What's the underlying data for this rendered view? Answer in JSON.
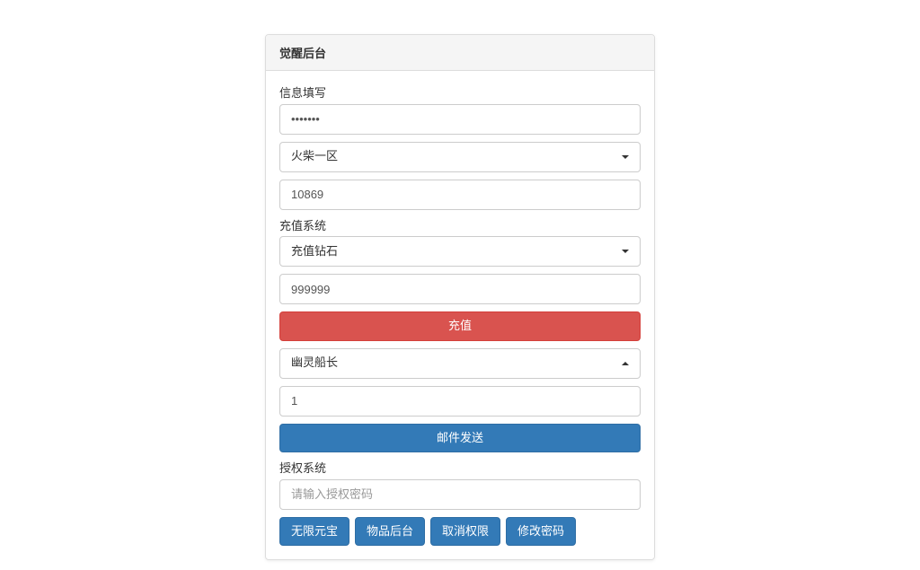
{
  "panel": {
    "title": "觉醒后台"
  },
  "info": {
    "label": "信息填写",
    "password_value": "•••••••",
    "region_selected": "火柴一区",
    "account_value": "10869"
  },
  "recharge": {
    "label": "充值系统",
    "type_selected": "充值钻石",
    "amount_value": "999999",
    "submit_label": "充值"
  },
  "mail": {
    "item_selected": "幽灵船长",
    "quantity_value": "1",
    "send_label": "邮件发送"
  },
  "auth": {
    "label": "授权系统",
    "password_placeholder": "请输入授权密码"
  },
  "footer": {
    "btn_unlimited": "无限元宝",
    "btn_item_admin": "物品后台",
    "btn_revoke": "取消权限",
    "btn_change_pw": "修改密码"
  }
}
